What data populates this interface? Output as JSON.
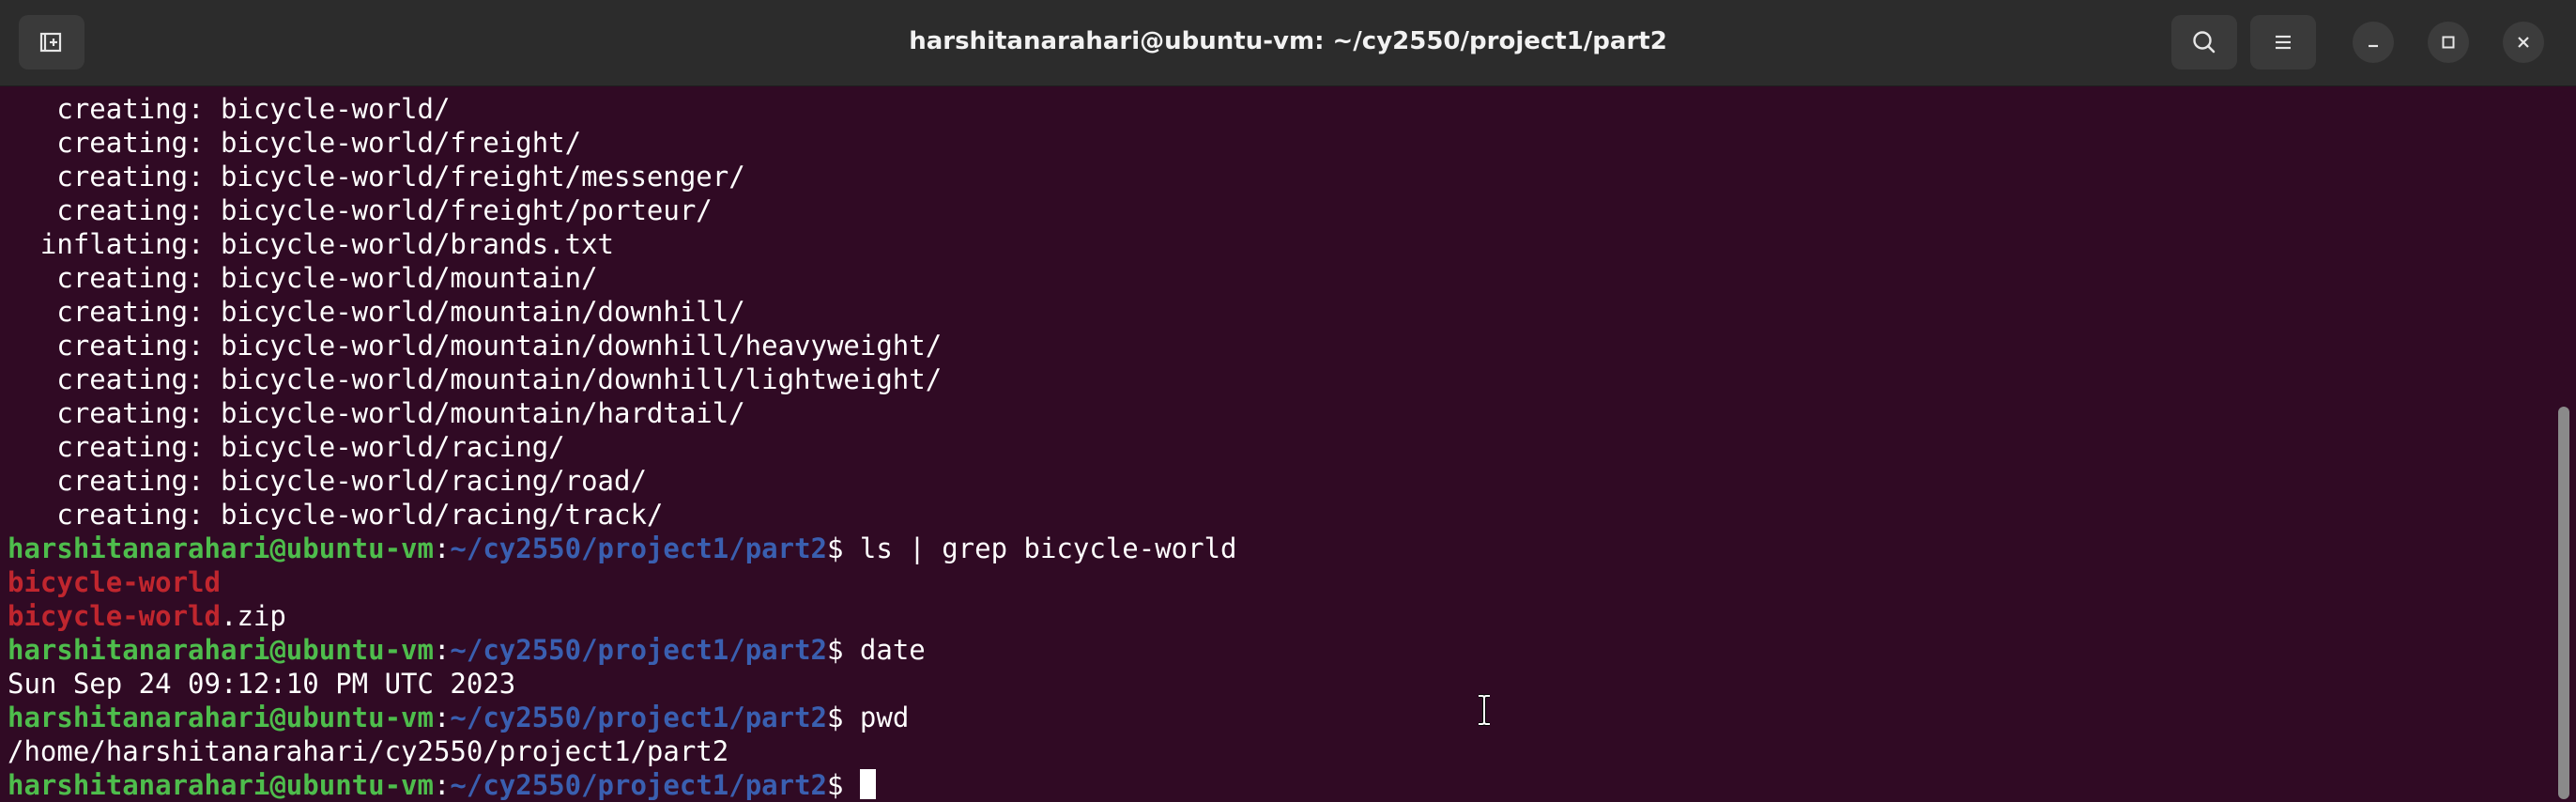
{
  "window": {
    "title": "harshitanarahari@ubuntu-vm: ~/cy2550/project1/part2",
    "buttons": [
      "new-tab",
      "search",
      "menu",
      "minimize",
      "maximize",
      "close"
    ]
  },
  "prompt": {
    "user_host": "harshitanarahari@ubuntu-vm",
    "colon": ":",
    "path": "~/cy2550/project1/part2",
    "dollar": "$ "
  },
  "output_lines": [
    "   creating: bicycle-world/",
    "   creating: bicycle-world/freight/",
    "   creating: bicycle-world/freight/messenger/",
    "   creating: bicycle-world/freight/porteur/",
    "  inflating: bicycle-world/brands.txt",
    "   creating: bicycle-world/mountain/",
    "   creating: bicycle-world/mountain/downhill/",
    "   creating: bicycle-world/mountain/downhill/heavyweight/",
    "   creating: bicycle-world/mountain/downhill/lightweight/",
    "   creating: bicycle-world/mountain/hardtail/",
    "   creating: bicycle-world/racing/",
    "   creating: bicycle-world/racing/road/",
    "   creating: bicycle-world/racing/track/"
  ],
  "commands": [
    {
      "command": "ls | grep bicycle-world",
      "results": [
        {
          "match": "bicycle-world",
          "rest": ""
        },
        {
          "match": "bicycle-world",
          "rest": ".zip"
        }
      ]
    },
    {
      "command": "date",
      "output": "Sun Sep 24 09:12:10 PM UTC 2023"
    },
    {
      "command": "pwd",
      "output": "/home/harshitanarahari/cy2550/project1/part2"
    }
  ],
  "icons": {
    "new_tab": "new-tab-icon",
    "search": "search-icon",
    "menu": "hamburger-menu-icon",
    "minimize": "minimize-icon",
    "maximize": "maximize-icon",
    "close": "close-icon",
    "mouse": "text-cursor-ibeam-icon"
  },
  "colors": {
    "terminal_background": "#300a24",
    "prompt_user": "#4ebd4c",
    "prompt_path": "#3a5fb0",
    "grep_match": "#c0262e",
    "titlebar": "#2c2c2c"
  }
}
